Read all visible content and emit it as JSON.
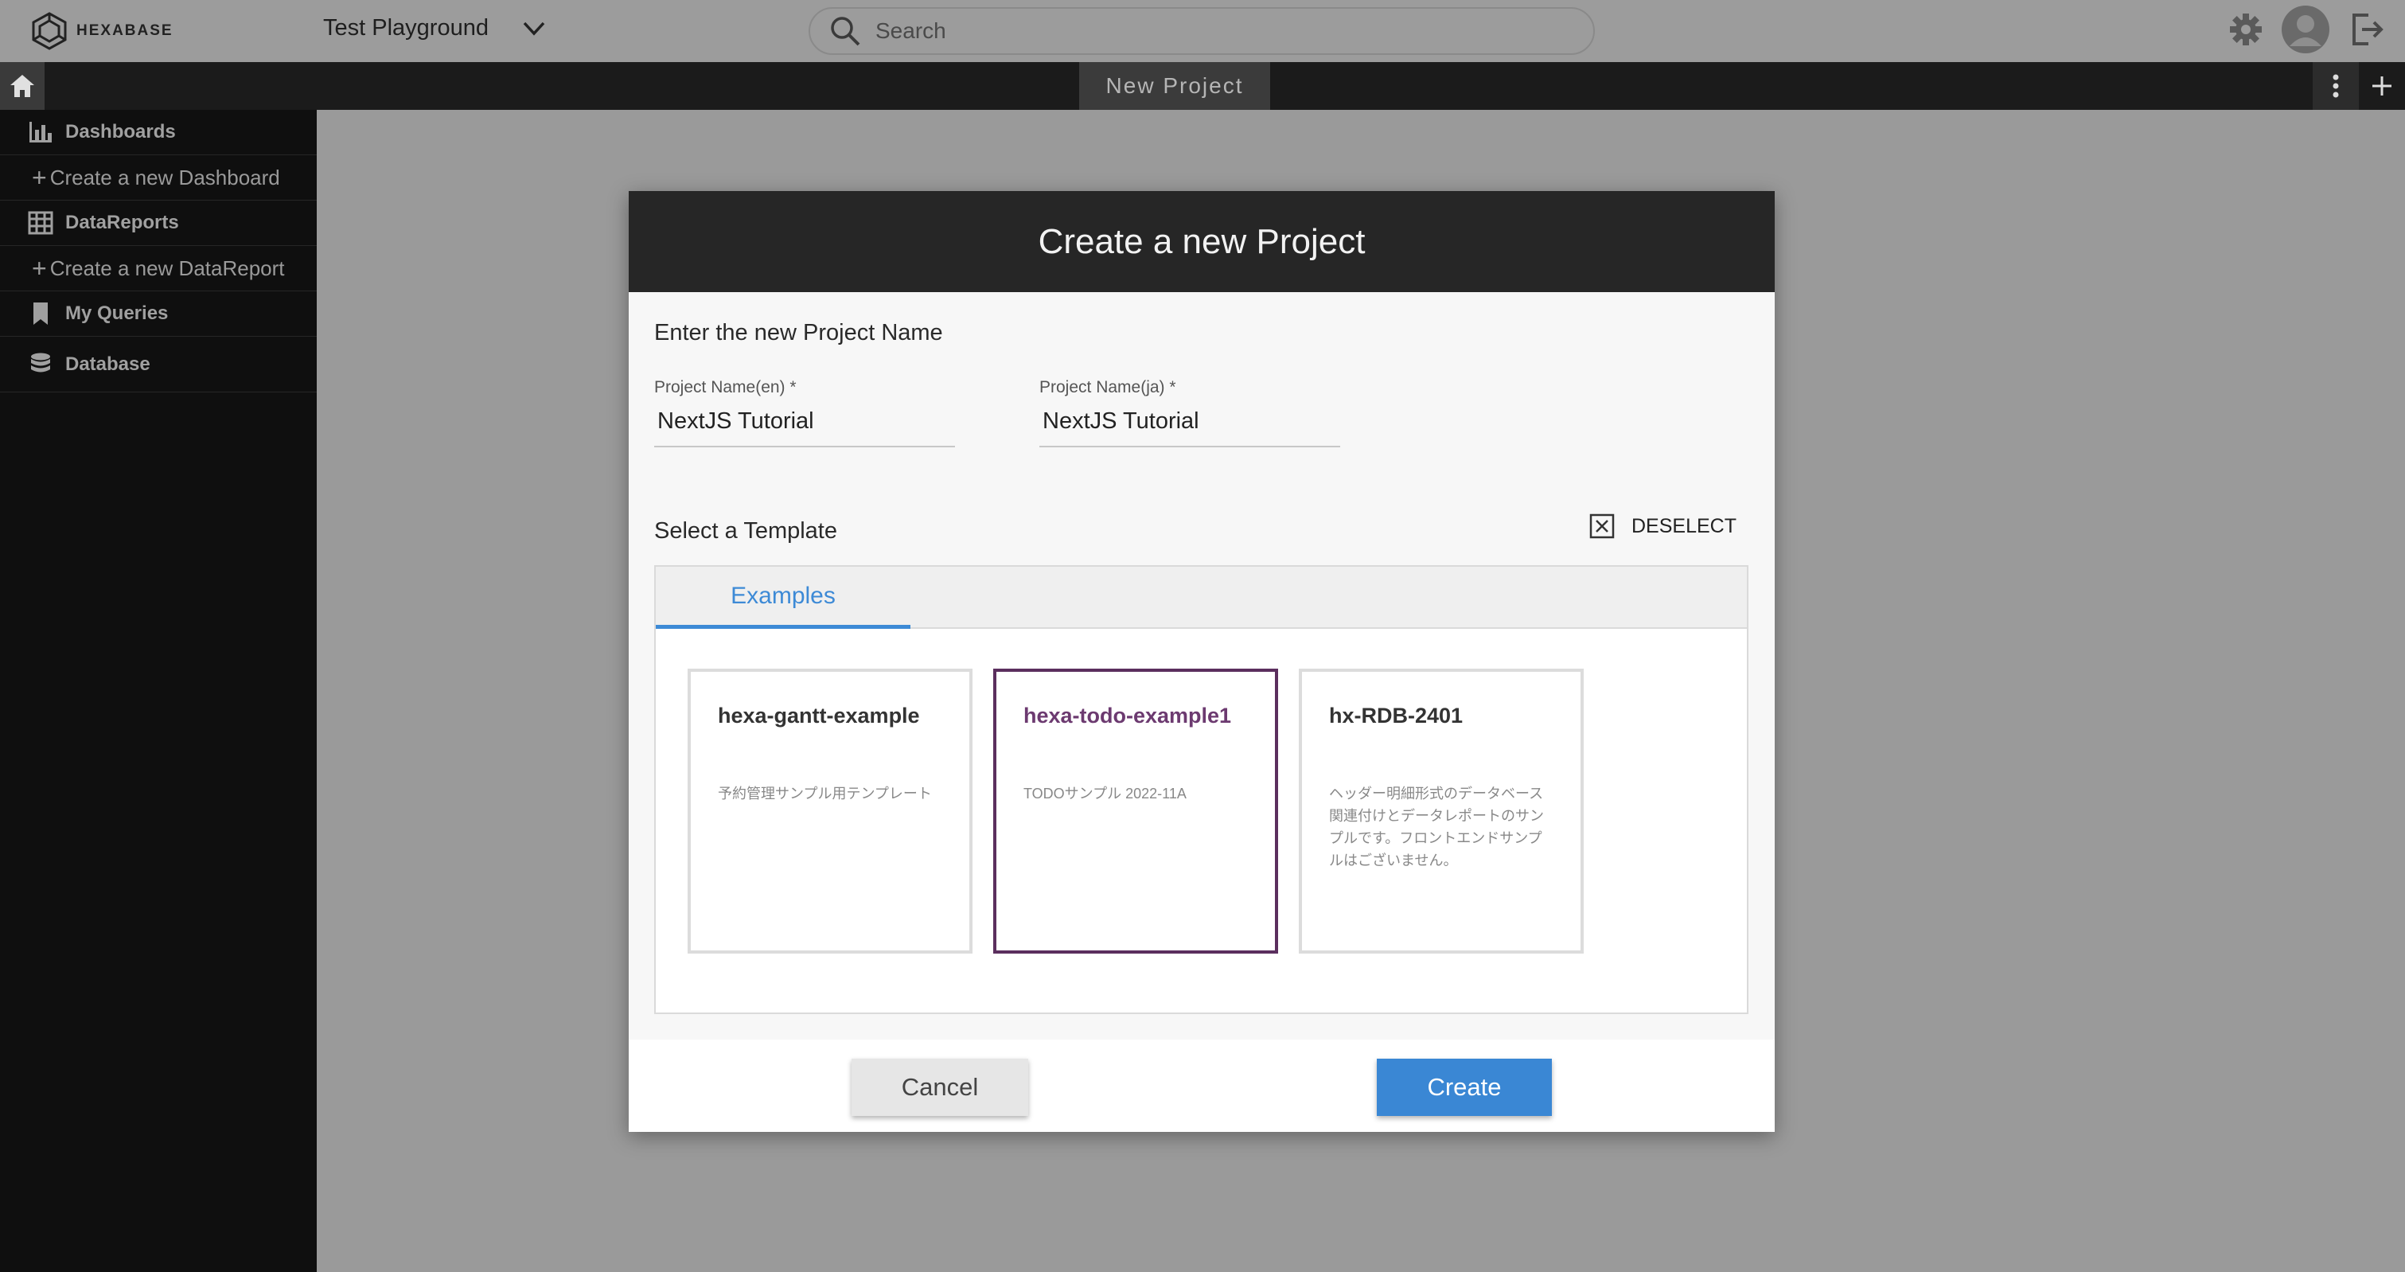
{
  "app": {
    "logo_text": "HEXABASE",
    "workspace_name": "Test Playground"
  },
  "search": {
    "placeholder": "Search"
  },
  "tabbar": {
    "active_tab": "New Project"
  },
  "sidebar": {
    "items": [
      {
        "label": "Dashboards",
        "icon": "bar-chart-icon"
      },
      {
        "label": "Create a new Dashboard",
        "icon": "plus-icon"
      },
      {
        "label": "DataReports",
        "icon": "table-grid-icon"
      },
      {
        "label": "Create a new DataReport",
        "icon": "plus-icon"
      },
      {
        "label": "My Queries",
        "icon": "bookmark-icon"
      },
      {
        "label": "Database",
        "icon": "database-icon"
      }
    ]
  },
  "modal": {
    "title": "Create a new Project",
    "name_section": "Enter the new Project Name",
    "field_en": {
      "label": "Project Name(en) *",
      "value": "NextJS Tutorial"
    },
    "field_ja": {
      "label": "Project Name(ja) *",
      "value": "NextJS Tutorial"
    },
    "template_section": "Select a Template",
    "deselect_label": "DESELECT",
    "template_tab": "Examples",
    "templates": [
      {
        "name": "hexa-gantt-example",
        "description": "予約管理サンプル用テンプレート"
      },
      {
        "name": "hexa-todo-example1",
        "description": "TODOサンプル 2022-11A"
      },
      {
        "name": "hx-RDB-2401",
        "description": "ヘッダー明細形式のデータベース関連付けとデータレポートのサンプルです。フロントエンドサンプルはございません。"
      }
    ],
    "selected_template": "hexa-todo-example1",
    "cancel_label": "Cancel",
    "create_label": "Create"
  },
  "colors": {
    "accent": "#3a87d4",
    "selected_border": "#5b2f5e",
    "header_bg": "#262626",
    "sidebar_bg": "#0f0f0f"
  }
}
